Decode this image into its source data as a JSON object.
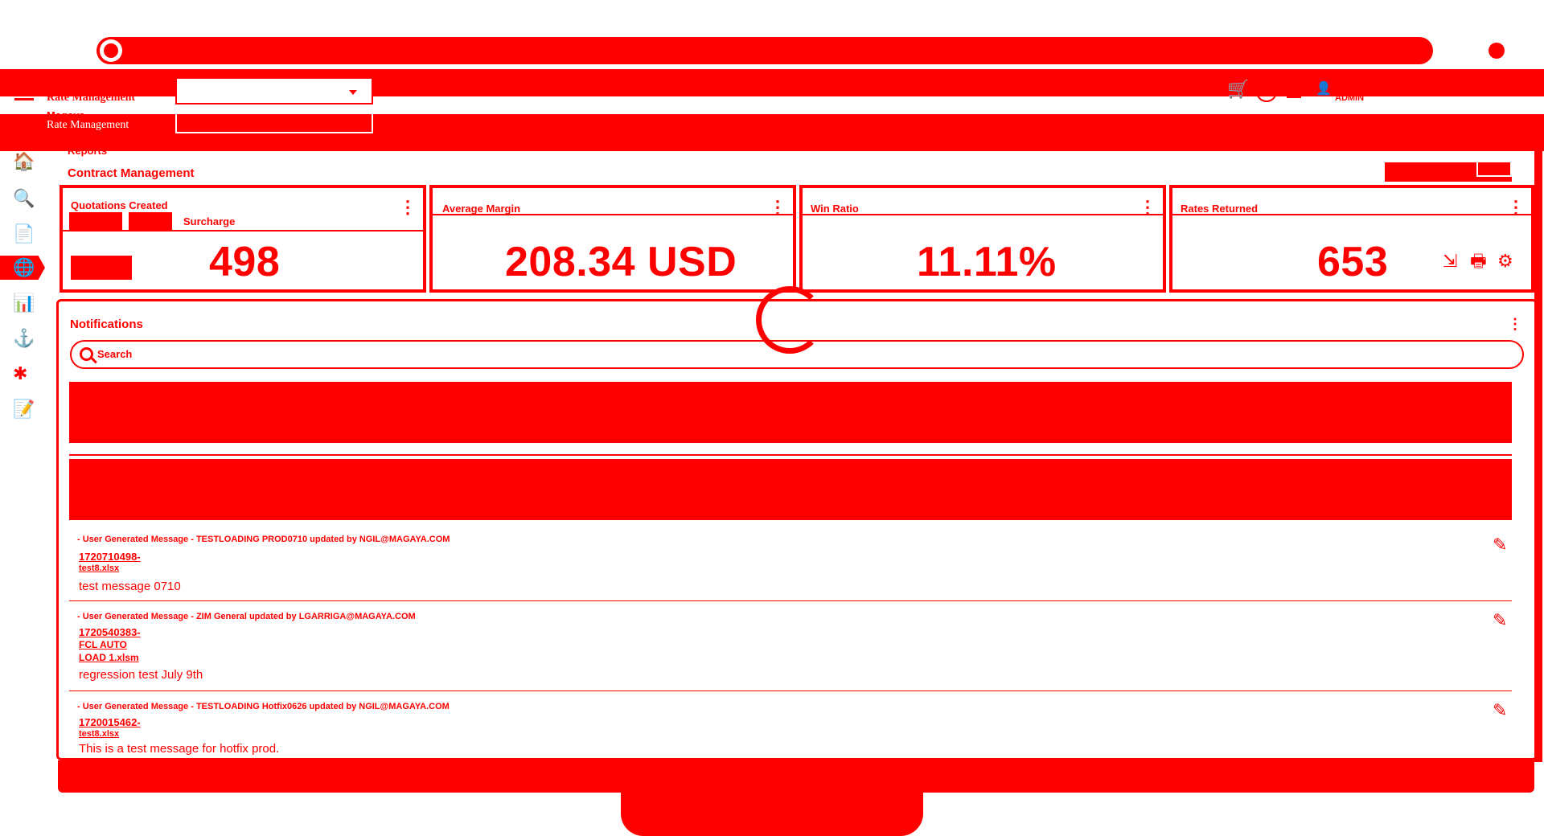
{
  "app": {
    "brand": "Magaya",
    "title": "Rate Management",
    "user": "ADMIN"
  },
  "breadcrumb": {
    "section": "Reports",
    "page": "Contract Management"
  },
  "cards": [
    {
      "title": "Quotations Created",
      "value": "498",
      "tab_surcharge": "Surcharge"
    },
    {
      "title": "Average Margin",
      "value": "208.34 USD"
    },
    {
      "title": "Win Ratio",
      "value": "11.11%"
    },
    {
      "title": "Rates Returned",
      "value": "653"
    }
  ],
  "notifications": {
    "title": "Notifications",
    "search_placeholder": "Search",
    "items": [
      {
        "header": "- User Generated Message - TESTLOADING PROD0710 updated by NGIL@MAGAYA.COM",
        "links": [
          "1720710498-",
          "test8.xlsx"
        ],
        "message": "test message 0710"
      },
      {
        "header": "- User Generated Message - ZIM General updated by LGARRIGA@MAGAYA.COM",
        "links": [
          "1720540383-",
          "FCL AUTO",
          "LOAD 1.xlsm"
        ],
        "message": "regression test July 9th"
      },
      {
        "header": "- User Generated Message - TESTLOADING Hotfix0626 updated by NGIL@MAGAYA.COM",
        "links": [
          "1720015462-",
          "test8.xlsx"
        ],
        "message": "This is a test message for hotfix prod."
      }
    ]
  },
  "colors": {
    "primary": "#ff0000",
    "background": "#ffffff"
  },
  "icons": [
    "home-icon",
    "search-user-icon",
    "document-icon",
    "rates-icon",
    "report-icon",
    "ship-icon",
    "network-icon",
    "edit-doc-icon",
    "cart-icon",
    "help-icon",
    "clipboard-icon",
    "user-icon",
    "export-icon",
    "print-icon",
    "gear-icon",
    "pencil-icon",
    "search-icon",
    "loading-spinner-icon"
  ]
}
